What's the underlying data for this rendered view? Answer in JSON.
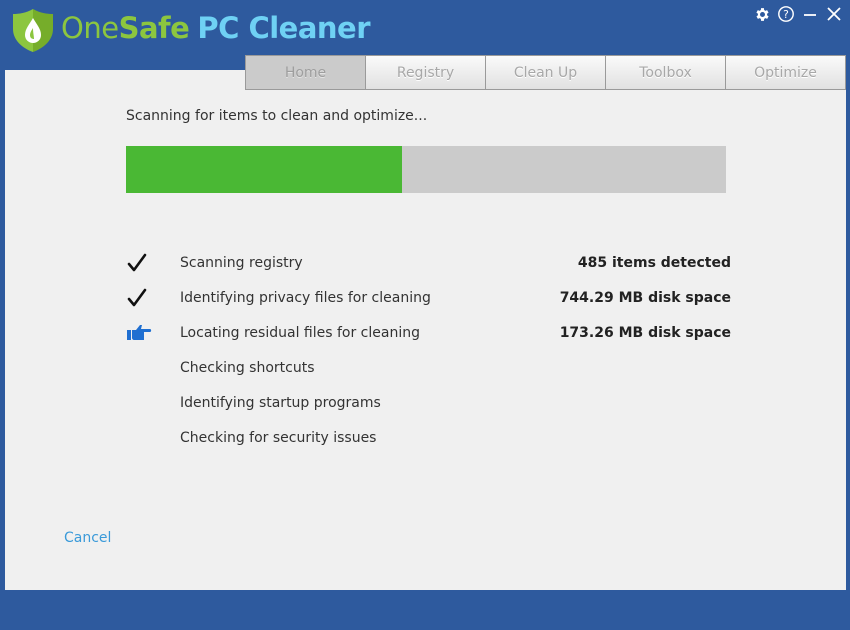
{
  "app": {
    "brand_part1": "One",
    "brand_part2": "Safe",
    "brand_part3": "PC Cleaner",
    "logo_icon": "shield-drop-icon",
    "brand_green": "#8cc63f",
    "brand_blue": "#6fd1f4"
  },
  "window_controls": [
    {
      "name": "settings",
      "icon": "gear-icon",
      "glyph": "⚙"
    },
    {
      "name": "help",
      "icon": "help-icon",
      "glyph": "?"
    },
    {
      "name": "minimize",
      "icon": "minimize-icon",
      "glyph": "—"
    },
    {
      "name": "close",
      "icon": "close-icon",
      "glyph": "✕"
    }
  ],
  "tabs": [
    {
      "label": "Home",
      "active": true
    },
    {
      "label": "Registry",
      "active": false
    },
    {
      "label": "Clean Up",
      "active": false
    },
    {
      "label": "Toolbox",
      "active": false
    },
    {
      "label": "Optimize",
      "active": false
    }
  ],
  "scan": {
    "status_text": "Scanning for items to clean and optimize...",
    "progress_percent": 46,
    "progress_color": "#4ab834",
    "tasks": [
      {
        "label": "Scanning registry",
        "state": "done",
        "icon": "checkmark-icon",
        "result": "485 items detected"
      },
      {
        "label": "Identifying privacy files for cleaning",
        "state": "done",
        "icon": "checkmark-icon",
        "result": "744.29 MB disk space"
      },
      {
        "label": "Locating residual files for cleaning",
        "state": "in-progress",
        "icon": "pointing-hand-icon",
        "result": "173.26 MB disk space"
      },
      {
        "label": "Checking shortcuts",
        "state": "pending",
        "icon": "",
        "result": ""
      },
      {
        "label": "Identifying startup programs",
        "state": "pending",
        "icon": "",
        "result": ""
      },
      {
        "label": "Checking for security issues",
        "state": "pending",
        "icon": "",
        "result": ""
      }
    ]
  },
  "cancel_label": "Cancel"
}
